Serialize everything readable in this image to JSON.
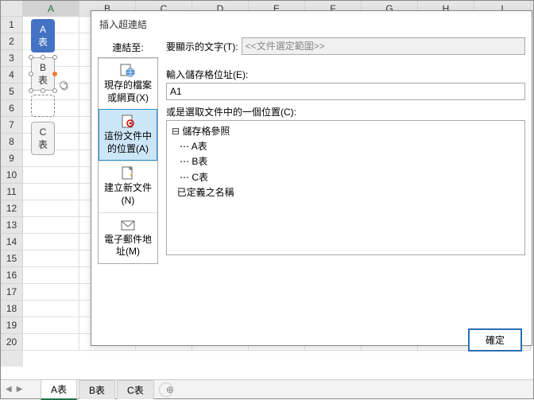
{
  "columns": [
    "A",
    "B",
    "C",
    "D",
    "E",
    "F",
    "G",
    "H",
    "I"
  ],
  "rows": [
    "1",
    "2",
    "3",
    "4",
    "5",
    "6",
    "7",
    "8",
    "9",
    "10",
    "11",
    "12",
    "13",
    "14",
    "15",
    "16",
    "17",
    "18",
    "19",
    "20"
  ],
  "shapes": {
    "a": {
      "line1": "A",
      "line2": "表"
    },
    "b": {
      "line1": "B",
      "line2": "表"
    },
    "c": {
      "line1": "C",
      "line2": "表"
    }
  },
  "dialog": {
    "title": "插入超連結",
    "link_to_label": "連結至:",
    "items": {
      "existing": "現存的檔案或網頁(X)",
      "place": "這份文件中的位置(A)",
      "newdoc": "建立新文件(N)",
      "email": "電子郵件地址(M)"
    },
    "display_label": "要顯示的文字(T):",
    "display_placeholder": "<<文件選定範圍>>",
    "ref_label": "輸入儲存格位址(E):",
    "ref_value": "A1",
    "tree_label": "或是選取文件中的一個位置(C):",
    "tree": {
      "root": "儲存格參照",
      "children": [
        "A表",
        "B表",
        "C表"
      ],
      "defined": "已定義之名稱"
    },
    "ok": "確定"
  },
  "tabs": [
    "A表",
    "B表",
    "C表"
  ]
}
